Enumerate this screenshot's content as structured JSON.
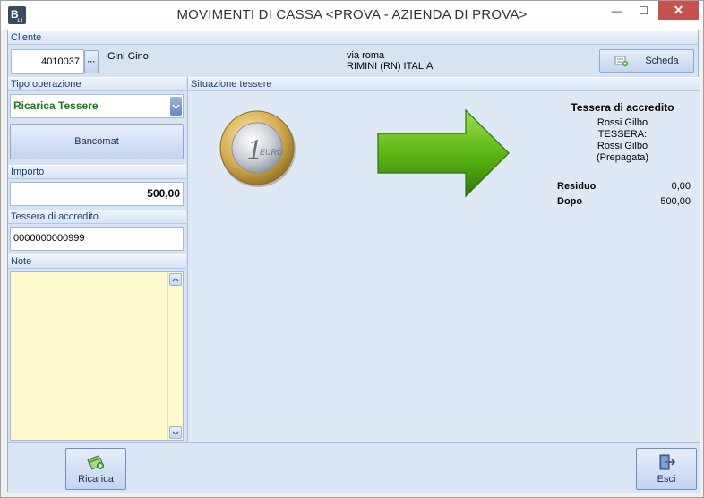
{
  "window": {
    "title": "MOVIMENTI DI CASSA <PROVA - AZIENDA DI PROVA>",
    "app_icon_text": "B",
    "app_icon_sub": "14",
    "minimize_glyph": "—",
    "maximize_glyph": "☐",
    "close_glyph": "✕"
  },
  "cliente": {
    "header": "Cliente",
    "code": "4010037",
    "lookup_glyph": "···",
    "name": "Gini Gino",
    "address_line1": "via roma",
    "address_line2": "RIMINI (RN) ITALIA",
    "scheda_label": "Scheda"
  },
  "tipo_operazione": {
    "header": "Tipo operazione",
    "selected": "Ricarica Tessere",
    "selected_color": "#1a7a1a"
  },
  "bancomat_label": "Bancomat",
  "importo": {
    "header": "Importo",
    "value": "500,00"
  },
  "tessera": {
    "header": "Tessera di accredito",
    "value": "0000000000999"
  },
  "note": {
    "header": "Note",
    "value": ""
  },
  "situazione": {
    "header": "Situazione tessere",
    "card_title": "Tessera di accredito",
    "card_lines": [
      "Rossi Gilbo",
      "TESSERA:",
      "Rossi Gilbo",
      "(Prepagata)"
    ],
    "residuo_label": "Residuo",
    "residuo_value": "0,00",
    "dopo_label": "Dopo",
    "dopo_value": "500,00",
    "coin_text": "EURO",
    "coin_value": "1"
  },
  "footer": {
    "ricarica_label": "Ricarica",
    "esci_label": "Esci"
  },
  "colors": {
    "accent_blue": "#1e3f70",
    "arrow_green": "#5cb814",
    "note_bg": "#fffacd"
  }
}
